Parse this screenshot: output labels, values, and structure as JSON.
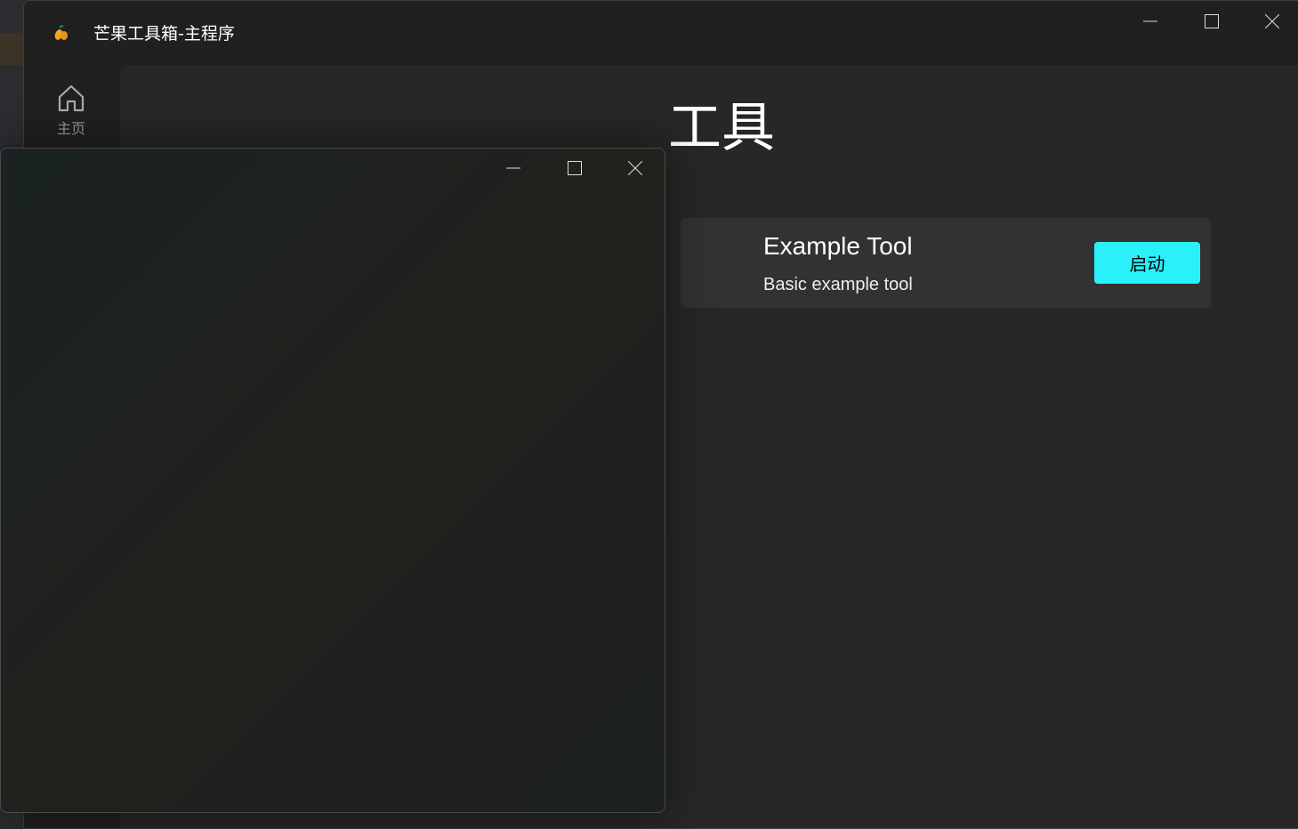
{
  "window": {
    "title": "芒果工具箱-主程序",
    "icon": "mango-icon"
  },
  "sidebar": {
    "items": [
      {
        "label": "主页",
        "icon": "home-icon"
      }
    ]
  },
  "main": {
    "heading": "工具",
    "tools": [
      {
        "name": "Example Tool",
        "description": "Basic example tool",
        "launch_label": "启动"
      }
    ]
  },
  "colors": {
    "accent": "#2af0fa"
  }
}
